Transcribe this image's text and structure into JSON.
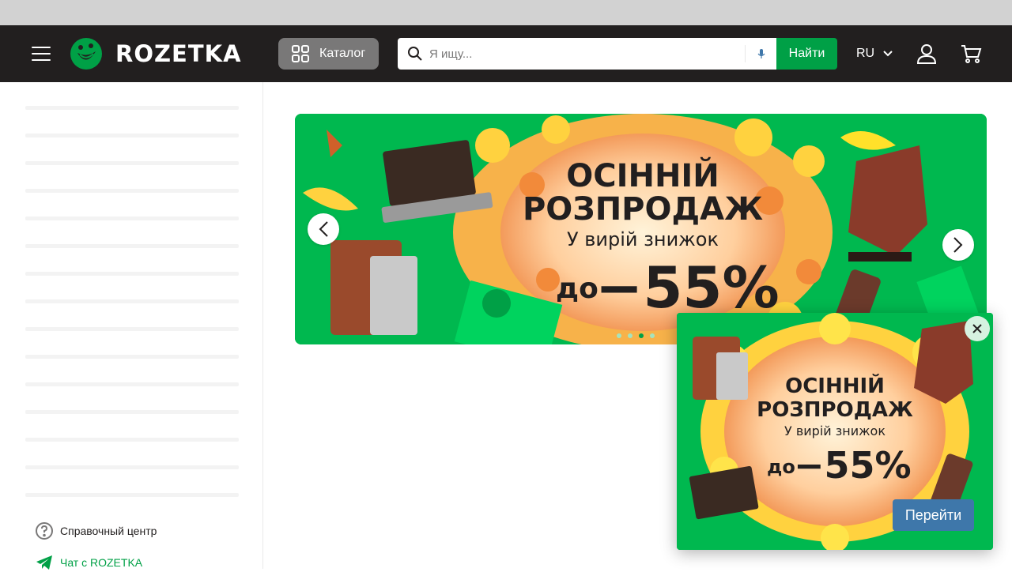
{
  "header": {
    "logo_text": "ROZETKA",
    "catalog_label": "Каталог",
    "search": {
      "placeholder": "Я ищу...",
      "button_label": "Найти"
    },
    "language": "RU"
  },
  "sidebar": {
    "help_label": "Справочный центр",
    "chat_label": "Чат с ROZETKA"
  },
  "banner": {
    "line1": "ОСІННІЙ",
    "line2": "РОЗПРОДАЖ",
    "line3": "У вирій знижок",
    "prefix": "до",
    "discount": "−55%",
    "slides_count": 4,
    "active_slide": 3
  },
  "popup": {
    "line1": "ОСІННІЙ",
    "line2": "РОЗПРОДАЖ",
    "line3": "У вирій знижок",
    "prefix": "до",
    "discount": "−55%",
    "button_label": "Перейти"
  },
  "colors": {
    "header_bg": "#221f1f",
    "brand_green": "#00a046",
    "banner_green": "#00b84f",
    "popup_button": "#3e77aa"
  }
}
